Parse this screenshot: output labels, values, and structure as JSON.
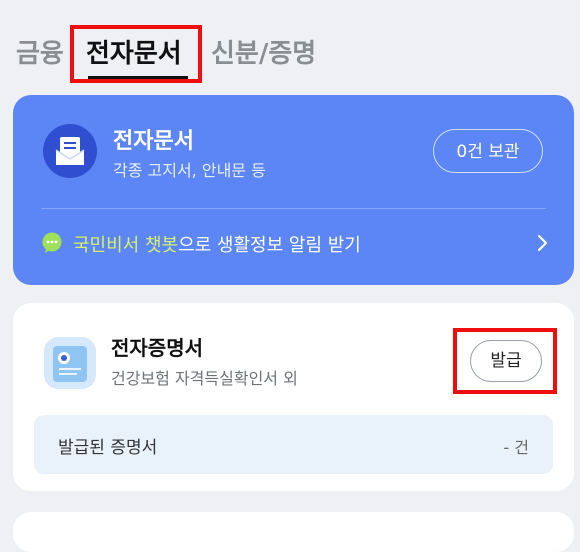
{
  "tabs": [
    {
      "label": "금융",
      "active": false
    },
    {
      "label": "전자문서",
      "active": true
    },
    {
      "label": "신분/증명",
      "active": false
    }
  ],
  "edoc": {
    "title": "전자문서",
    "subtitle": "각종 고지서, 안내문 등",
    "storage_button": "0건 보관",
    "chatbot_highlight": "국민비서 챗봇",
    "chatbot_rest": "으로 생활정보 알림 받기"
  },
  "cert": {
    "title": "전자증명서",
    "subtitle": "건강보험 자격득실확인서 외",
    "issue_button": "발급",
    "issued_label": "발급된 증명서",
    "issued_count": "- 건"
  },
  "colors": {
    "accent_blue": "#5c86f5",
    "highlight_red": "#ee0e0e",
    "chatbot_green": "#d6f26a"
  },
  "icons": [
    "envelope-document-icon",
    "chat-bubble-icon",
    "chevron-right-icon",
    "certificate-icon"
  ]
}
